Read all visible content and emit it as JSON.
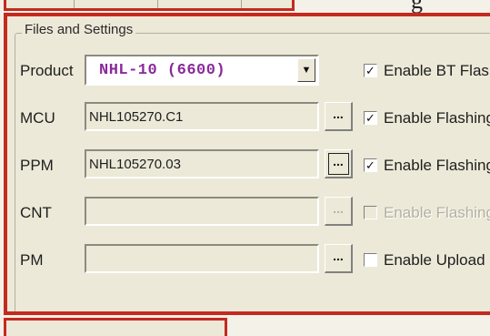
{
  "groupbox": {
    "title": "Files and Settings"
  },
  "rows": {
    "product": {
      "label": "Product",
      "value": "NHL-10  (6600)",
      "checkbox_label": "Enable BT Flash",
      "checked": true
    },
    "mcu": {
      "label": "MCU",
      "value": "NHL105270.C1",
      "button": "...",
      "checkbox_label": "Enable Flashing",
      "checked": true
    },
    "ppm": {
      "label": "PPM",
      "value": "NHL105270.03",
      "button": "...",
      "checkbox_label": "Enable Flashing",
      "checked": true
    },
    "cnt": {
      "label": "CNT",
      "value": "",
      "button": "...",
      "checkbox_label": "Enable Flashing",
      "checked": false,
      "disabled": true
    },
    "pm": {
      "label": "PM",
      "value": "",
      "button": "...",
      "checkbox_label": "Enable Upload",
      "checked": false
    }
  },
  "icons": {
    "dropdown": "dropdown-arrow-icon",
    "check": "checkmark-icon"
  },
  "colors": {
    "highlight_frame": "#c42a1f",
    "product_text": "#8a2a9a"
  },
  "partial": {
    "top_glyph": "g"
  }
}
